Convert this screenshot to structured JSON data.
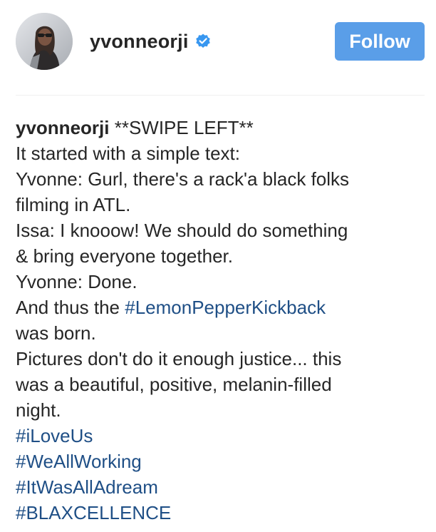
{
  "header": {
    "username": "yvonneorji",
    "verified": true,
    "follow_label": "Follow"
  },
  "caption": {
    "author": "yvonneorji",
    "first_text": " **SWIPE LEFT**",
    "lines": [
      "It started with a simple text:",
      "Yvonne: Gurl, there's a rack'a black folks",
      "filming in ATL.",
      "Issa: I knooow! We should do something",
      "& bring everyone together.",
      "Yvonne: Done."
    ],
    "thus_prefix": "And thus the ",
    "thus_hashtag": "#LemonPepperKickback",
    "was_born": "was born.",
    "lines2": [
      "Pictures don't do it enough justice... this",
      "was a beautiful, positive, melanin-filled",
      "night."
    ],
    "hashtags": [
      "#iLoveUs",
      "#WeAllWorking",
      "#ItWasAllAdream",
      "#BLAXCELLENCE"
    ]
  },
  "colors": {
    "follow_button": "#5a9ee8",
    "hashtag": "#1f4f86",
    "verified_badge": "#3897f0"
  }
}
